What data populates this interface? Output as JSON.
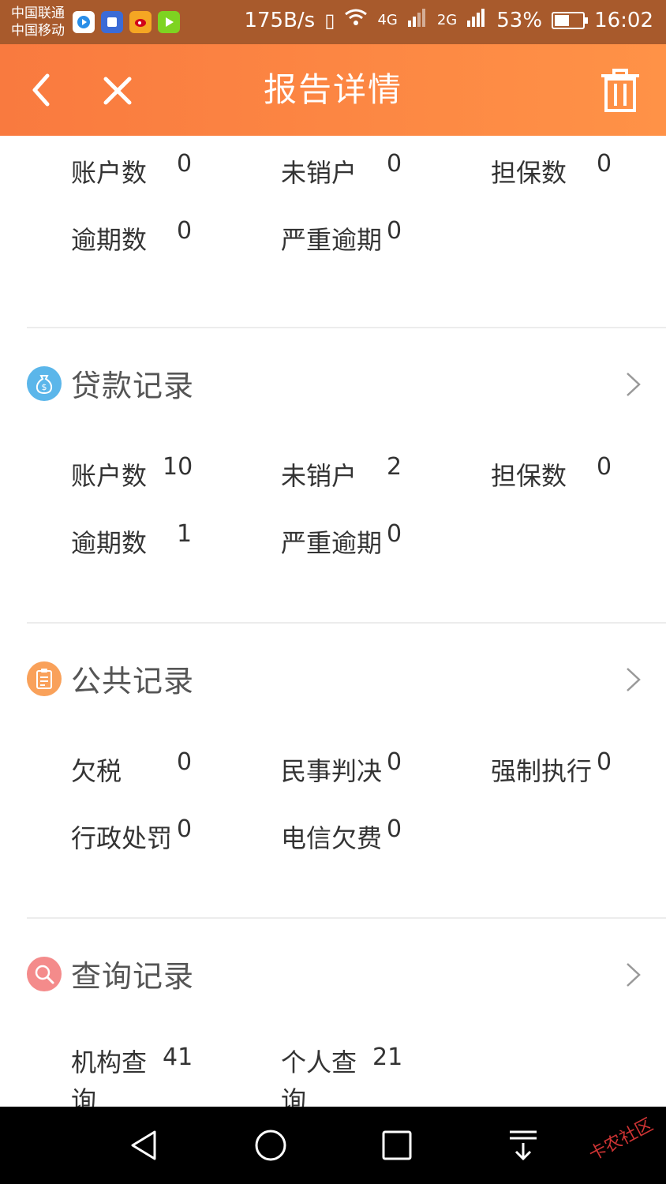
{
  "status_bar": {
    "carrier_1": "中国联通",
    "carrier_2": "中国移动",
    "speed": "175B/s",
    "net_4g": "4G",
    "net_2g": "2G",
    "battery": "53%",
    "battery_level": 0.53,
    "time": "16:02",
    "apps": [
      "video-app-icon",
      "tieba-icon",
      "weibo-icon",
      "player-app-icon"
    ]
  },
  "header": {
    "title": "报告详情",
    "back_icon": "back-arrow-icon",
    "close_icon": "close-icon",
    "trash_icon": "trash-icon"
  },
  "credit_card_summary": {
    "account_count_label": "账户数",
    "account_count": "0",
    "active_label": "未销户",
    "active": "0",
    "guarantee_label": "担保数",
    "guarantee": "0",
    "overdue_label": "逾期数",
    "overdue": "0",
    "serious_overdue_label": "严重逾期",
    "serious_overdue": "0"
  },
  "loan_records": {
    "title": "贷款记录",
    "icon": "money-bag-icon",
    "icon_color": "#5bb6ea",
    "account_count_label": "账户数",
    "account_count": "10",
    "active_label": "未销户",
    "active": "2",
    "guarantee_label": "担保数",
    "guarantee": "0",
    "overdue_label": "逾期数",
    "overdue": "1",
    "serious_overdue_label": "严重逾期",
    "serious_overdue": "0"
  },
  "public_records": {
    "title": "公共记录",
    "icon": "clipboard-icon",
    "icon_color": "#f9a15a",
    "tax_label": "欠税",
    "tax": "0",
    "civil_label": "民事判决",
    "civil": "0",
    "enforce_label": "强制执行",
    "enforce": "0",
    "admin_label": "行政处罚",
    "admin": "0",
    "telecom_label": "电信欠费",
    "telecom": "0"
  },
  "query_records": {
    "title": "查询记录",
    "icon": "search-icon",
    "icon_color": "#f48b8b",
    "org_label": "机构查询",
    "org": "41",
    "personal_label": "个人查询",
    "personal": "21"
  },
  "navbar": {
    "back": "nav-back-icon",
    "home": "nav-home-icon",
    "recent": "nav-recent-icon",
    "notification": "nav-pull-down-icon"
  },
  "watermark": "卡农社区"
}
